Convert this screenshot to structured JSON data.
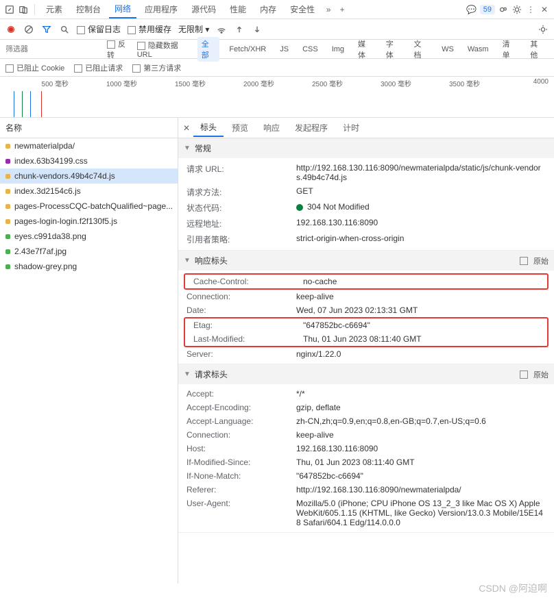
{
  "topTabs": {
    "elements": "元素",
    "console": "控制台",
    "network": "网络",
    "application": "应用程序",
    "sources": "源代码",
    "performance": "性能",
    "memory": "内存",
    "security": "安全性",
    "badge": "59"
  },
  "toolbar": {
    "preserve": "保留日志",
    "disableCache": "禁用缓存",
    "throttle": "无限制"
  },
  "filter": {
    "placeholder": "筛选器",
    "invert": "反转",
    "hideData": "隐藏数据 URL",
    "all": "全部",
    "fetch": "Fetch/XHR",
    "js": "JS",
    "css": "CSS",
    "img": "Img",
    "media": "媒体",
    "font": "字体",
    "doc": "文档",
    "ws": "WS",
    "wasm": "Wasm",
    "manifest": "清单",
    "other": "其他"
  },
  "cookies": {
    "blockedCookie": "已阻止 Cookie",
    "blockedReq": "已阻止请求",
    "thirdParty": "第三方请求"
  },
  "timeline": {
    "t1": "500 毫秒",
    "t2": "1000 毫秒",
    "t3": "1500 毫秒",
    "t4": "2000 毫秒",
    "t5": "2500 毫秒",
    "t6": "3000 毫秒",
    "t7": "3500 毫秒",
    "t8": "4000"
  },
  "fileHeader": "名称",
  "files": [
    {
      "name": "newmaterialpda/",
      "color": "#e8b34a"
    },
    {
      "name": "index.63b34199.css",
      "color": "#9c27b0"
    },
    {
      "name": "chunk-vendors.49b4c74d.js",
      "color": "#e8b34a"
    },
    {
      "name": "index.3d2154c6.js",
      "color": "#e8b34a"
    },
    {
      "name": "pages-ProcessCQC-batchQualified~page...",
      "color": "#e8b34a"
    },
    {
      "name": "pages-login-login.f2f130f5.js",
      "color": "#e8b34a"
    },
    {
      "name": "eyes.c991da38.png",
      "color": "#4caf50"
    },
    {
      "name": "2.43e7f7af.jpg",
      "color": "#4caf50"
    },
    {
      "name": "shadow-grey.png",
      "color": "#4caf50"
    }
  ],
  "detailTabs": {
    "headers": "标头",
    "preview": "预览",
    "response": "响应",
    "initiator": "发起程序",
    "timing": "计时"
  },
  "general": {
    "title": "常规",
    "urlK": "请求 URL:",
    "urlV": "http://192.168.130.116:8090/newmaterialpda/static/js/chunk-vendors.49b4c74d.js",
    "methodK": "请求方法:",
    "methodV": "GET",
    "statusK": "状态代码:",
    "statusV": "304 Not Modified",
    "remoteK": "远程地址:",
    "remoteV": "192.168.130.116:8090",
    "policyK": "引用者策略:",
    "policyV": "strict-origin-when-cross-origin"
  },
  "respHead": {
    "title": "响应标头",
    "raw": "原始",
    "cacheK": "Cache-Control:",
    "cacheV": "no-cache",
    "connK": "Connection:",
    "connV": "keep-alive",
    "dateK": "Date:",
    "dateV": "Wed, 07 Jun 2023 02:13:31 GMT",
    "etagK": "Etag:",
    "etagV": "\"647852bc-c6694\"",
    "lmK": "Last-Modified:",
    "lmV": "Thu, 01 Jun 2023 08:11:40 GMT",
    "serverK": "Server:",
    "serverV": "nginx/1.22.0"
  },
  "reqHead": {
    "title": "请求标头",
    "raw": "原始",
    "acceptK": "Accept:",
    "acceptV": "*/*",
    "aeK": "Accept-Encoding:",
    "aeV": "gzip, deflate",
    "alK": "Accept-Language:",
    "alV": "zh-CN,zh;q=0.9,en;q=0.8,en-GB;q=0.7,en-US;q=0.6",
    "connK": "Connection:",
    "connV": "keep-alive",
    "hostK": "Host:",
    "hostV": "192.168.130.116:8090",
    "imsK": "If-Modified-Since:",
    "imsV": "Thu, 01 Jun 2023 08:11:40 GMT",
    "inmK": "If-None-Match:",
    "inmV": "\"647852bc-c6694\"",
    "refK": "Referer:",
    "refV": "http://192.168.130.116:8090/newmaterialpda/",
    "uaK": "User-Agent:",
    "uaV": "Mozilla/5.0 (iPhone; CPU iPhone OS 13_2_3 like Mac OS X) AppleWebKit/605.1.15 (KHTML, like Gecko) Version/13.0.3 Mobile/15E148 Safari/604.1 Edg/114.0.0.0"
  },
  "watermark": "CSDN @阿迫啊"
}
